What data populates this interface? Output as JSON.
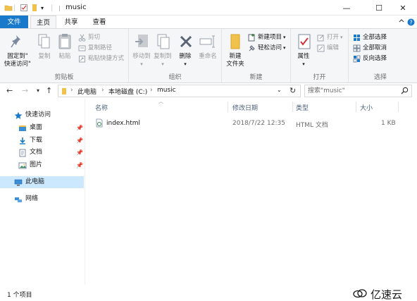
{
  "window": {
    "title": "music",
    "minimize_glyph": "—",
    "maximize_glyph": "☐",
    "close_glyph": "✕"
  },
  "tabs": [
    {
      "label": "文件"
    },
    {
      "label": "主页"
    },
    {
      "label": "共享"
    },
    {
      "label": "查看"
    }
  ],
  "ribbon": {
    "clipboard": {
      "label": "剪贴板",
      "pin": "固定到\"\n快速访问\"",
      "pin_line1": "固定到\"",
      "pin_line2": "快速访问\"",
      "copy": "复制",
      "paste": "粘贴",
      "cut": "剪切",
      "copy_path": "复制路径",
      "paste_shortcut": "粘贴快捷方式"
    },
    "organize": {
      "label": "组织",
      "move_to": "移动到",
      "copy_to": "复制到",
      "delete": "删除",
      "rename": "重命名"
    },
    "new": {
      "label": "新建",
      "new_folder_line1": "新建",
      "new_folder_line2": "文件夹",
      "new_item": "新建项目",
      "easy_access": "轻松访问"
    },
    "open": {
      "label": "打开",
      "properties": "属性",
      "open": "打开",
      "edit": "编辑"
    },
    "select": {
      "label": "选择",
      "select_all": "全部选择",
      "select_none": "全部取消",
      "invert": "反向选择"
    }
  },
  "address": {
    "crumbs": [
      "此电脑",
      "本地磁盘 (C:)",
      "music"
    ],
    "search_placeholder": "搜索\"music\""
  },
  "nav": {
    "quick_access": "快速访问",
    "desktop": "桌面",
    "downloads": "下载",
    "documents": "文档",
    "pictures": "图片",
    "this_pc": "此电脑",
    "network": "网络"
  },
  "columns": {
    "name": "名称",
    "date": "修改日期",
    "type": "类型",
    "size": "大小"
  },
  "files": [
    {
      "name": "index.html",
      "date": "2018/7/22 12:35",
      "type": "HTML 文档",
      "size": "1 KB"
    }
  ],
  "status": {
    "count": "1 个项目"
  },
  "watermark": "亿速云",
  "colors": {
    "accent": "#1979ca",
    "folder": "#f0c24b",
    "selected": "#cce8ff"
  }
}
